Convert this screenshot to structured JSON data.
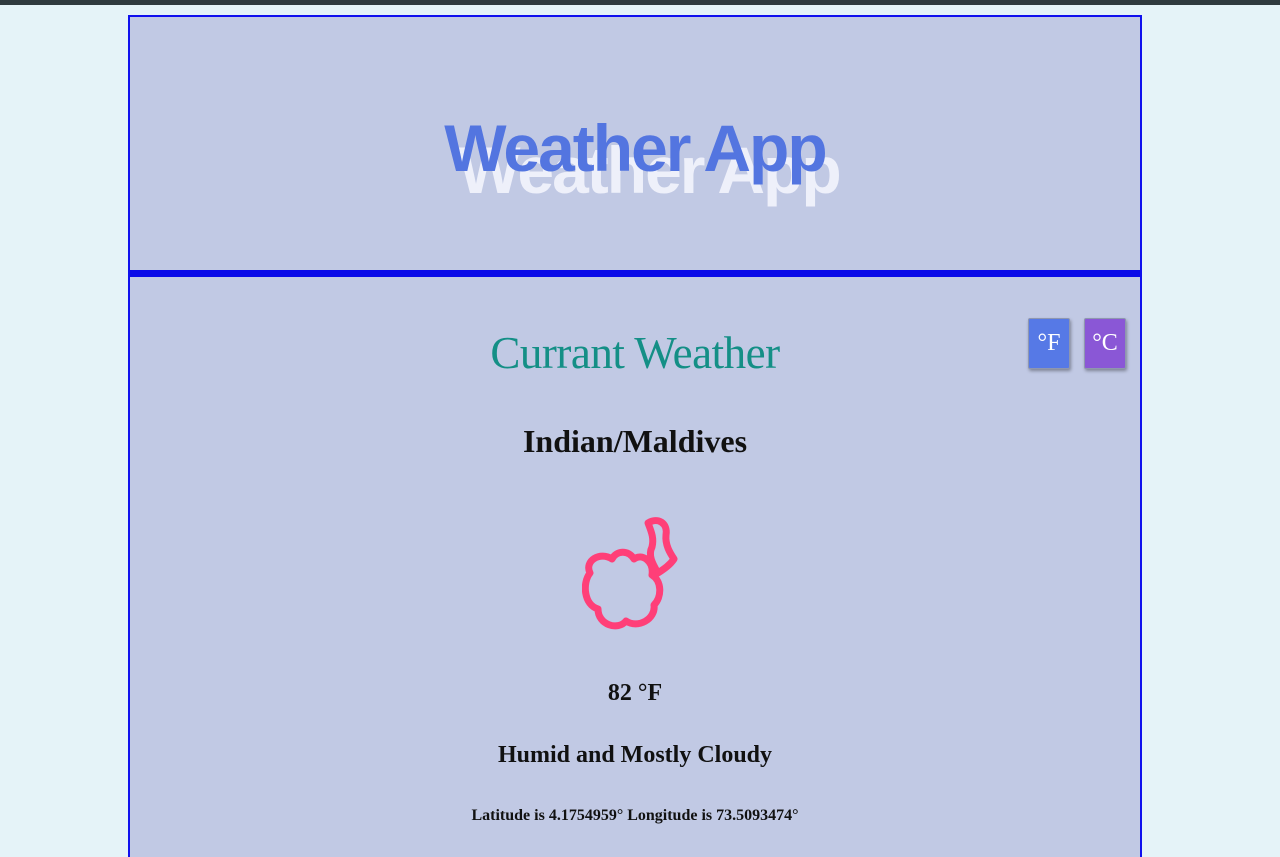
{
  "app": {
    "title": "Weather App"
  },
  "weather": {
    "section_title": "Currant Weather",
    "location": "Indian/Maldives",
    "icon": "partly-cloudy-night-icon",
    "temperature": "82 °F",
    "condition": "Humid and Mostly Cloudy",
    "coordinates": "Latitude is 4.1754959° Longitude is 73.5093474°"
  },
  "units": {
    "fahrenheit_label": "°F",
    "celsius_label": "°C"
  },
  "colors": {
    "background": "#e5f3f8",
    "panel": "#c1c9e4",
    "border": "#0a0ae8",
    "title": "#5375e0",
    "section_title": "#148f86",
    "icon": "#ff3f78",
    "fahrenheit_button": "#5679e6",
    "celsius_button": "#8a57d6"
  }
}
